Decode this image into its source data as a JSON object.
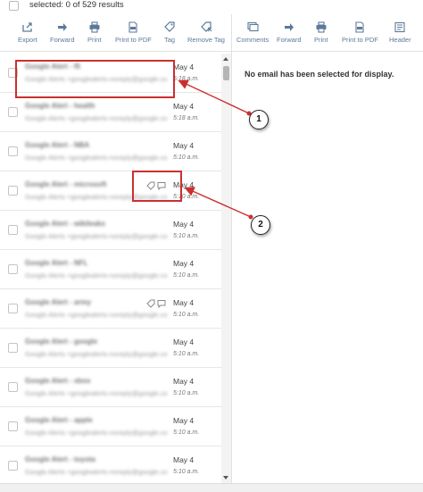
{
  "header": {
    "selected_text": "selected: 0 of 529 results"
  },
  "toolbar_left": [
    {
      "id": "export",
      "label": "Export",
      "icon": "export-icon"
    },
    {
      "id": "forward",
      "label": "Forward",
      "icon": "forward-icon"
    },
    {
      "id": "print",
      "label": "Print",
      "icon": "print-icon"
    },
    {
      "id": "print-pdf",
      "label": "Print to PDF",
      "icon": "pdf-icon"
    },
    {
      "id": "tag",
      "label": "Tag",
      "icon": "tag-icon"
    },
    {
      "id": "remove-tag",
      "label": "Remove Tag",
      "icon": "remove-tag-icon"
    }
  ],
  "toolbar_right": [
    {
      "id": "comments",
      "label": "Comments",
      "icon": "comments-icon"
    },
    {
      "id": "forward",
      "label": "Forward",
      "icon": "forward-icon"
    },
    {
      "id": "print",
      "label": "Print",
      "icon": "print-icon"
    },
    {
      "id": "print-pdf",
      "label": "Print to PDF",
      "icon": "pdf-icon"
    },
    {
      "id": "header",
      "label": "Header",
      "icon": "header-icon"
    }
  ],
  "emails": [
    {
      "subject": "Google Alert - f5",
      "from": "Google Alerts <googlealerts-noreply@google.com>",
      "date": "May 4",
      "time": "5:18 a.m.",
      "icons": false
    },
    {
      "subject": "Google Alert - health",
      "from": "Google Alerts <googlealerts-noreply@google.com>",
      "date": "May 4",
      "time": "5:18 a.m.",
      "icons": false
    },
    {
      "subject": "Google Alert - NBA",
      "from": "Google Alerts <googlealerts-noreply@google.com>",
      "date": "May 4",
      "time": "5:10 a.m.",
      "icons": false
    },
    {
      "subject": "Google Alert - microsoft",
      "from": "Google Alerts <googlealerts-noreply@google.com>",
      "date": "May 4",
      "time": "5:10 a.m.",
      "icons": true
    },
    {
      "subject": "Google Alert - wikileaks",
      "from": "Google Alerts <googlealerts-noreply@google.com>",
      "date": "May 4",
      "time": "5:10 a.m.",
      "icons": false
    },
    {
      "subject": "Google Alert - NFL",
      "from": "Google Alerts <googlealerts-noreply@google.com>",
      "date": "May 4",
      "time": "5:10 a.m.",
      "icons": false
    },
    {
      "subject": "Google Alert - army",
      "from": "Google Alerts <googlealerts-noreply@google.com>",
      "date": "May 4",
      "time": "5:10 a.m.",
      "icons": true
    },
    {
      "subject": "Google Alert - google",
      "from": "Google Alerts <googlealerts-noreply@google.com>",
      "date": "May 4",
      "time": "5:10 a.m.",
      "icons": false
    },
    {
      "subject": "Google Alert - xbox",
      "from": "Google Alerts <googlealerts-noreply@google.com>",
      "date": "May 4",
      "time": "5:10 a.m.",
      "icons": false
    },
    {
      "subject": "Google Alert - apple",
      "from": "Google Alerts <googlealerts-noreply@google.com>",
      "date": "May 4",
      "time": "5:10 a.m.",
      "icons": false
    },
    {
      "subject": "Google Alert - toyota",
      "from": "Google Alerts <googlealerts-noreply@google.com>",
      "date": "May 4",
      "time": "5:10 a.m.",
      "icons": false
    }
  ],
  "reading_pane": {
    "empty_message": "No email has been selected for display."
  },
  "annotations": [
    {
      "number": "1"
    },
    {
      "number": "2"
    }
  ],
  "colors": {
    "toolbar_icon": "#5b7a99",
    "annotation": "#cc2f2f"
  }
}
